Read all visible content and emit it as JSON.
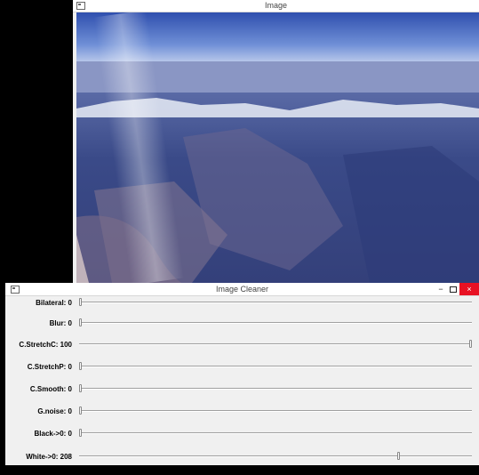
{
  "image_window": {
    "title": "Image"
  },
  "cleaner_window": {
    "title": "Image Cleaner",
    "controls": {
      "minimize": "−",
      "maximize": "",
      "close": "×"
    },
    "trackbars": [
      {
        "label": "Bilateral: 0",
        "value": 0,
        "max": 100,
        "ticks": "sparse"
      },
      {
        "label": "Blur: 0",
        "value": 0,
        "max": 100,
        "ticks": "sparse"
      },
      {
        "label": "C.StretchC: 100",
        "value": 100,
        "max": 100,
        "ticks": "dense"
      },
      {
        "label": "C.StretchP: 0",
        "value": 0,
        "max": 100,
        "ticks": "dense"
      },
      {
        "label": "C.Smooth: 0",
        "value": 0,
        "max": 100,
        "ticks": "dense"
      },
      {
        "label": "G.noise: 0",
        "value": 0,
        "max": 100,
        "ticks": "dense"
      },
      {
        "label": "Black->0: 0",
        "value": 0,
        "max": 255,
        "ticks": "dense"
      },
      {
        "label": "White->0: 208",
        "value": 208,
        "max": 255,
        "ticks": "dense"
      }
    ]
  }
}
